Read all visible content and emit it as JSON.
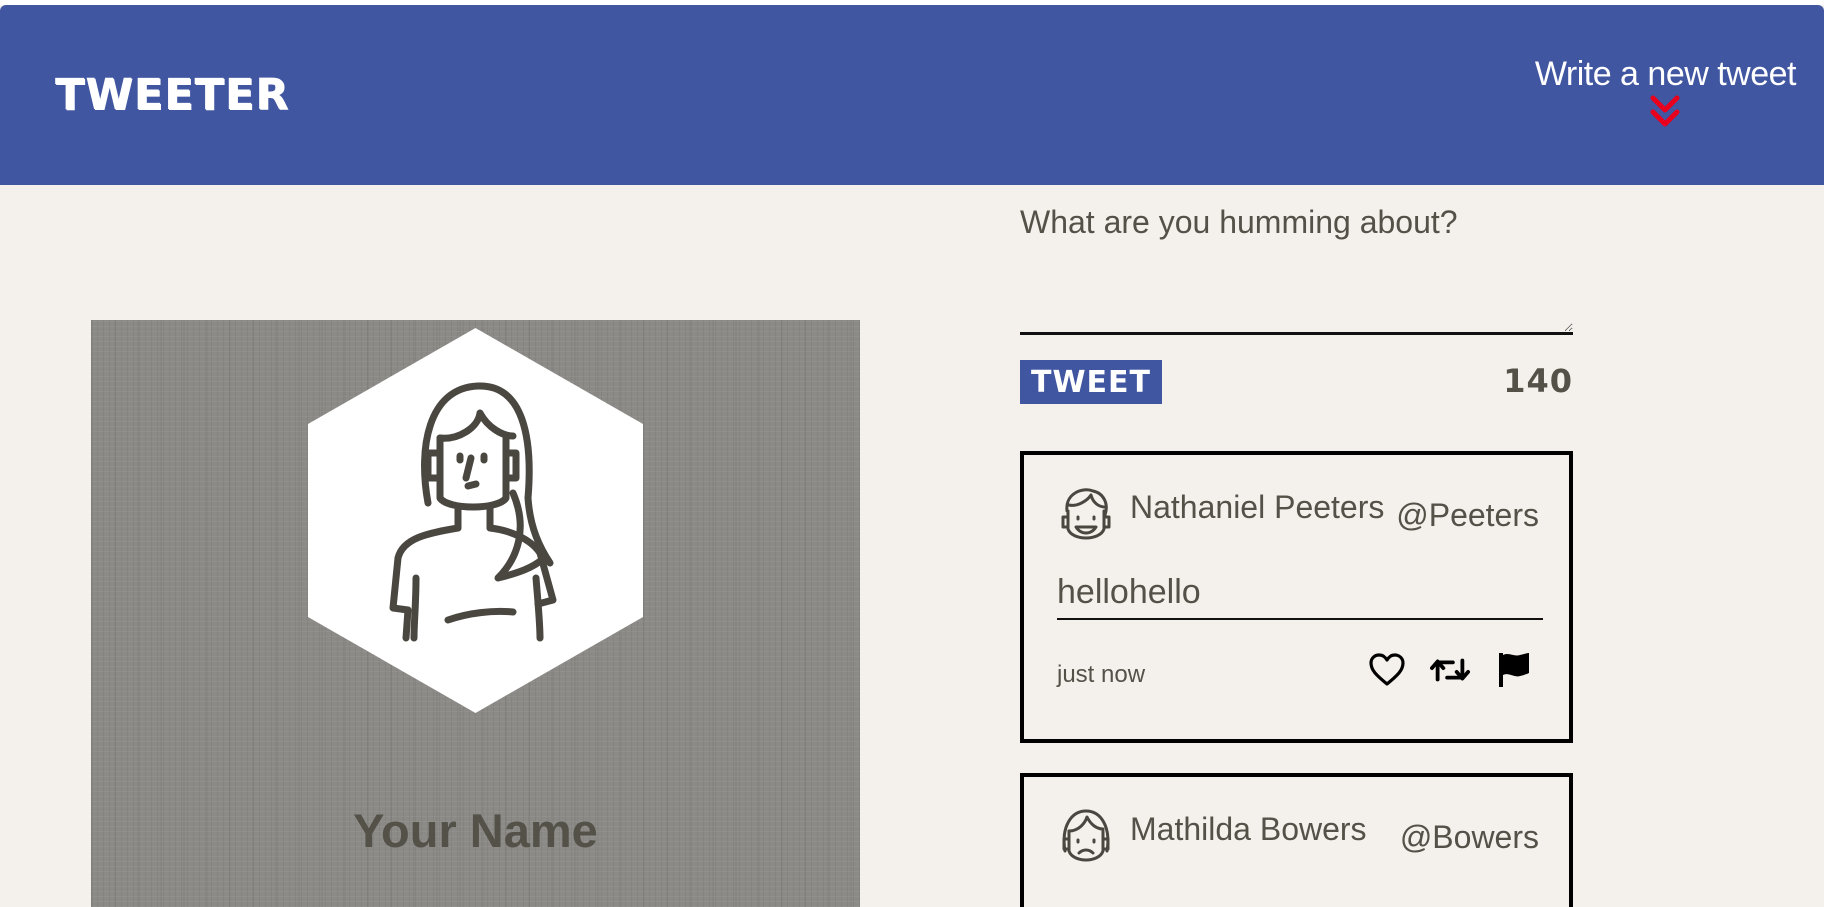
{
  "nav": {
    "brand": "TWEETER",
    "compose_label": "Write a new tweet",
    "compose_icon": "chevron-double-down-icon",
    "chevron_color": "#e8001c"
  },
  "colors": {
    "primary": "#4056a1",
    "background": "#f4f1ec",
    "text": "#545149",
    "profile_bg": "#8c8a87"
  },
  "profile": {
    "name": "Your Name",
    "avatar_icon": "woman-avatar-icon"
  },
  "composer": {
    "placeholder": "What are you humming about?",
    "value": "",
    "submit_label": "TWEET",
    "counter": "140"
  },
  "tweets": [
    {
      "name": "Nathaniel Peeters",
      "handle": "@Peeters",
      "content": "hellohello",
      "timestamp": "just now",
      "avatar_icon": "smiling-man-avatar-icon",
      "actions": [
        "heart-icon",
        "retweet-icon",
        "flag-icon"
      ]
    },
    {
      "name": "Mathilda Bowers",
      "handle": "@Bowers",
      "avatar_icon": "sad-woman-avatar-icon"
    }
  ]
}
